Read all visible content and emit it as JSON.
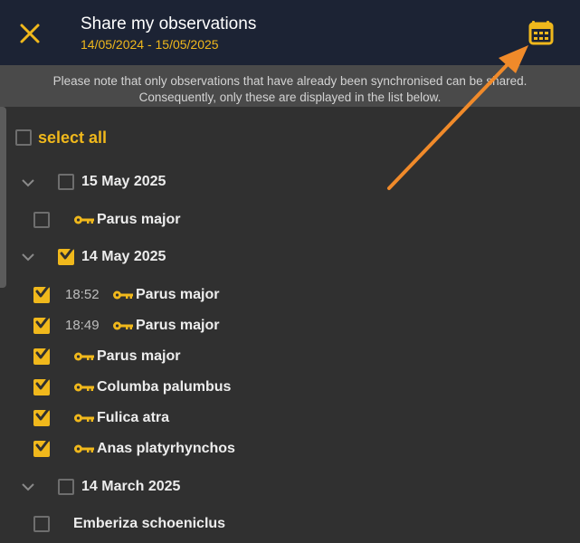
{
  "header": {
    "title": "Share my observations",
    "date_range": "14/05/2024 - 15/05/2025"
  },
  "notice": {
    "line1": "Please note that only observations that have already been synchronised can be shared.",
    "line2": "Consequently, only these are displayed in the list below."
  },
  "select_all": {
    "label": "select all",
    "checked": false
  },
  "groups": [
    {
      "date": "15 May 2025",
      "checked": false,
      "items": [
        {
          "time": "",
          "species": "Parus major",
          "has_key": true,
          "checked": false
        }
      ]
    },
    {
      "date": "14 May 2025",
      "checked": true,
      "items": [
        {
          "time": "18:52",
          "species": "Parus major",
          "has_key": true,
          "checked": true
        },
        {
          "time": "18:49",
          "species": "Parus major",
          "has_key": true,
          "checked": true
        },
        {
          "time": "",
          "species": "Parus major",
          "has_key": true,
          "checked": true
        },
        {
          "time": "",
          "species": "Columba palumbus",
          "has_key": true,
          "checked": true
        },
        {
          "time": "",
          "species": "Fulica atra",
          "has_key": true,
          "checked": true
        },
        {
          "time": "",
          "species": "Anas platyrhynchos",
          "has_key": true,
          "checked": true
        }
      ]
    },
    {
      "date": "14 March 2025",
      "checked": false,
      "items": [
        {
          "time": "",
          "species": "Emberiza schoeniclus",
          "has_key": false,
          "checked": false
        }
      ]
    }
  ],
  "icons": {
    "close": "close-icon",
    "calendar": "calendar-icon",
    "chevron": "chevron-down-icon",
    "key": "key-icon",
    "checkmark": "checkmark-icon"
  },
  "colors": {
    "accent": "#f0b81c",
    "header_bg": "#1c2334",
    "notice_bg": "#4a4a4a",
    "body_bg": "#303030",
    "annotation_arrow": "#f08a2a"
  }
}
